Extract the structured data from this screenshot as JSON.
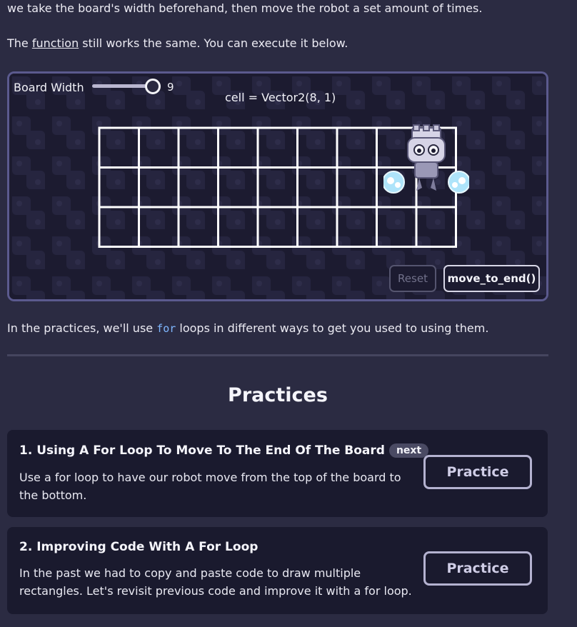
{
  "intro": {
    "line1": "we take the board's width beforehand, then move the robot a set amount of times.",
    "line2_prefix": "The ",
    "line2_link": "function",
    "line2_suffix": " still works the same. You can execute it below."
  },
  "demo": {
    "board_width_label": "Board Width",
    "board_width_value": "9",
    "slider_fraction": 1.0,
    "cell_readout": "cell = Vector2(8, 1)",
    "grid": {
      "columns": 9,
      "rows": 3,
      "robot_cell": [
        8,
        1
      ]
    },
    "reset_label": "Reset",
    "run_label": "move_to_end()"
  },
  "after_demo": {
    "prefix": "In the practices, we'll use ",
    "code": "for",
    "suffix": " loops in different ways to get you used to using them."
  },
  "practices": {
    "heading": "Practices",
    "items": [
      {
        "title": "1. Using A For Loop To Move To The End Of The Board",
        "badge": "next",
        "description": "Use a for loop to have our robot move from the top of the board to the bottom.",
        "button": "Practice"
      },
      {
        "title": "2. Improving Code With A For Loop",
        "description": "In the past we had to copy and paste code to draw multiple rectangles. Let's revisit previous code and improve it with a for loop.",
        "button": "Practice"
      }
    ]
  },
  "colors": {
    "page_bg": "#2b2b42",
    "card_bg": "#1a1a2e",
    "demo_border": "#5b5a8e",
    "code_text": "#7fb7ff"
  }
}
